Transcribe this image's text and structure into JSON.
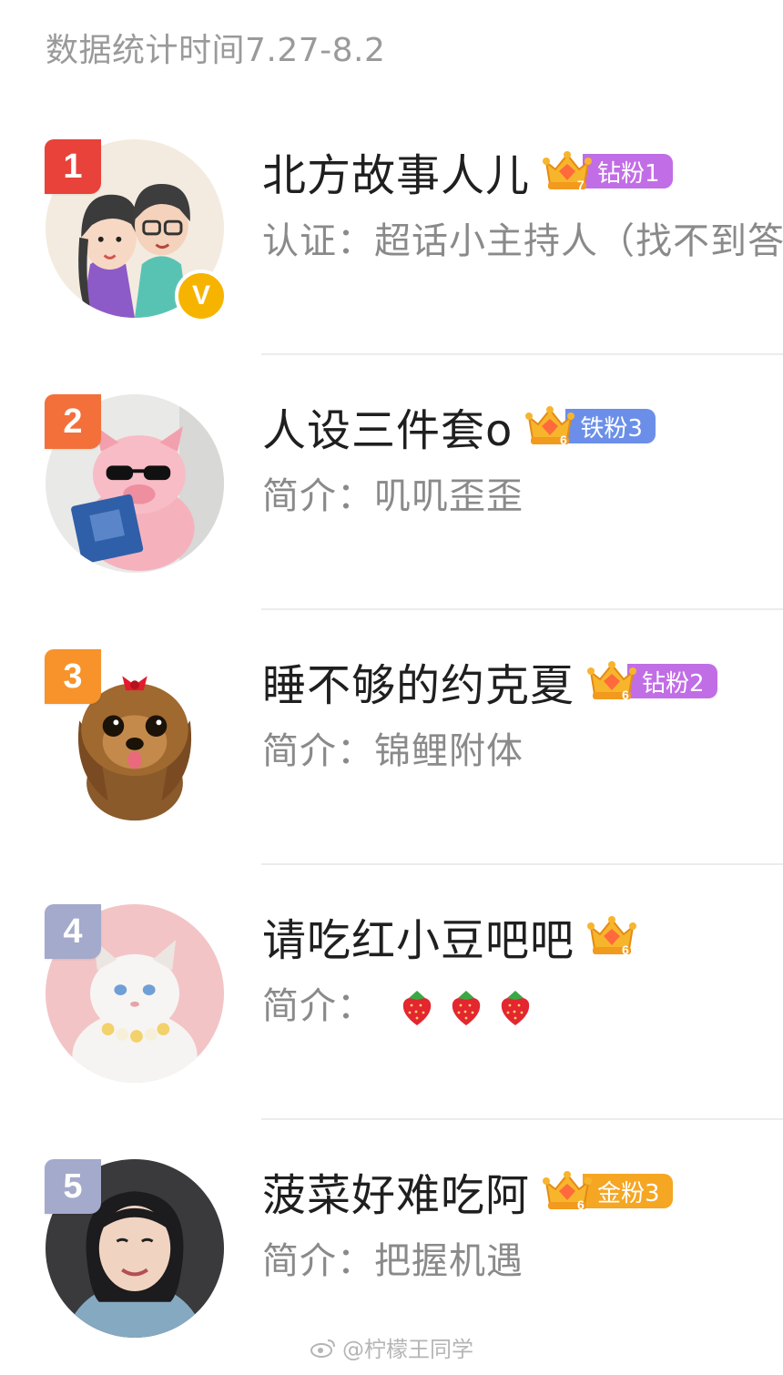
{
  "header": {
    "title": "数据统计时间7.27-8.2"
  },
  "colors": {
    "rank1": "#e8423a",
    "rank2": "#f3703a",
    "rank3": "#f7932a",
    "rank4": "#a3aacb",
    "rank5": "#a3aacb",
    "fan_diamond": "#c16ee6",
    "fan_iron": "#6b8fe9",
    "fan_gold": "#f5a623",
    "verified": "#f6b400"
  },
  "rows": [
    {
      "rank": "1",
      "name": "北方故事人儿",
      "crown_level": "7",
      "fan_label": "钻粉1",
      "desc_label": "认证：",
      "desc_text": "超话小主持人（找不到答",
      "avatar_icon": "couple-illustration-avatar",
      "verified_mark": "V"
    },
    {
      "rank": "2",
      "name": "人设三件套o",
      "crown_level": "6",
      "fan_label": "铁粉3",
      "desc_label": "简介：",
      "desc_text": "叽叽歪歪",
      "avatar_icon": "pig-with-sunglasses-avatar"
    },
    {
      "rank": "3",
      "name": "睡不够的约克夏",
      "crown_level": "6",
      "fan_label": "钻粉2",
      "desc_label": "简介：",
      "desc_text": "锦鲤附体",
      "avatar_icon": "yorkshire-dog-avatar"
    },
    {
      "rank": "4",
      "name": "请吃红小豆吧吧",
      "crown_level": "6",
      "fan_label": "",
      "desc_label": "简介：",
      "desc_emojis": [
        "strawberry-icon",
        "strawberry-icon",
        "strawberry-icon"
      ],
      "avatar_icon": "white-cat-avatar"
    },
    {
      "rank": "5",
      "name": "菠菜好难吃阿",
      "crown_level": "6",
      "fan_label": "金粉3",
      "desc_label": "简介：",
      "desc_text": "把握机遇",
      "avatar_icon": "girl-portrait-avatar"
    }
  ],
  "watermark": {
    "text": "@柠檬王同学"
  }
}
